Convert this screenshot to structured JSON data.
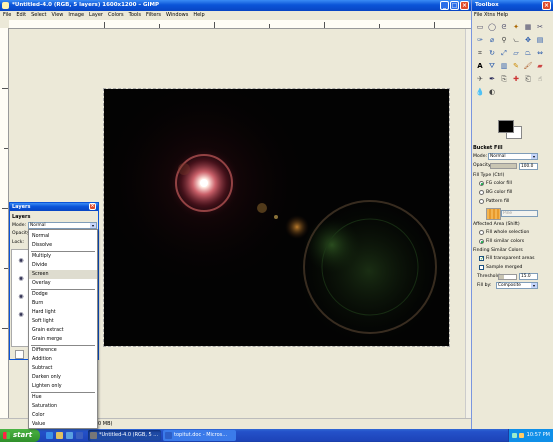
{
  "main_window": {
    "title": "*Untitled-4.0 (RGB, 5 layers) 1600x1200 – GIMP",
    "menu": [
      "File",
      "Edit",
      "Select",
      "View",
      "Image",
      "Layer",
      "Colors",
      "Tools",
      "Filters",
      "Windows",
      "Help"
    ],
    "status": "0 MB)"
  },
  "toolbox": {
    "title": "Toolbox",
    "tool_icons": [
      "rect-select",
      "ellipse-select",
      "free-select",
      "fuzzy-select",
      "select-by-color",
      "scissors",
      "paths",
      "color-picker",
      "zoom",
      "measure",
      "move",
      "align",
      "crop",
      "rotate",
      "scale",
      "shear",
      "perspective",
      "flip",
      "text",
      "bucket-fill",
      "blend",
      "pencil",
      "paintbrush",
      "eraser",
      "airbrush",
      "ink",
      "clone",
      "heal",
      "perspective-clone",
      "smudge",
      "blur",
      "dodge-burn"
    ],
    "active_tool": "bucket-fill",
    "tool_options": {
      "header": "Bucket Fill",
      "mode_label": "Mode:",
      "mode_value": "Normal",
      "opacity_label": "Opacity:",
      "opacity_value": "100.0",
      "opacity_fraction": 1.0,
      "fill_type_header": "Fill Type  (Ctrl)",
      "fill_types": [
        "FG color fill",
        "BG color fill",
        "Pattern fill"
      ],
      "fill_type_selected": 0,
      "pattern_name": "Pine",
      "affected_header": "Affected Area  (Shift)",
      "affected_options": [
        "Fill whole selection",
        "Fill similar colors"
      ],
      "affected_selected": 1,
      "finding_header": "Finding Similar Colors",
      "fill_transparent_label": "Fill transparent areas",
      "fill_transparent_checked": true,
      "sample_merged_label": "Sample merged",
      "sample_merged_checked": false,
      "threshold_label": "Threshold:",
      "threshold_value": "15.0",
      "fill_by_label": "Fill by:",
      "fill_by_value": "Composite"
    }
  },
  "layers_dialog": {
    "title": "Layers",
    "tab_label": "Layers",
    "mode_label": "Mode:",
    "mode_value": "Normal",
    "opacity_label": "Opacity:",
    "lock_label": "Lock:"
  },
  "mode_menu": {
    "items": [
      "Normal",
      "Dissolve",
      "Multiply",
      "Divide",
      "Screen",
      "Overlay",
      "Dodge",
      "Burn",
      "Hard light",
      "Soft light",
      "Grain extract",
      "Grain merge",
      "Difference",
      "Addition",
      "Subtract",
      "Darken only",
      "Lighten only",
      "Hue",
      "Saturation",
      "Color",
      "Value"
    ],
    "highlighted": "Screen"
  },
  "taskbar": {
    "start_label": "start",
    "tasks": [
      {
        "label": "*Untitled-4.0 (RGB, 5 ...",
        "active": true
      },
      {
        "label": "topitut.doc - Micros...",
        "active": false
      }
    ],
    "clock": "10:57 PM"
  },
  "colors": {
    "titlebar": "#0a54d8",
    "taskbar": "#2451c9",
    "start": "#2f8f2a",
    "foreground": "#000000",
    "background": "#ffffff",
    "flare_core": "#ff8a80"
  }
}
